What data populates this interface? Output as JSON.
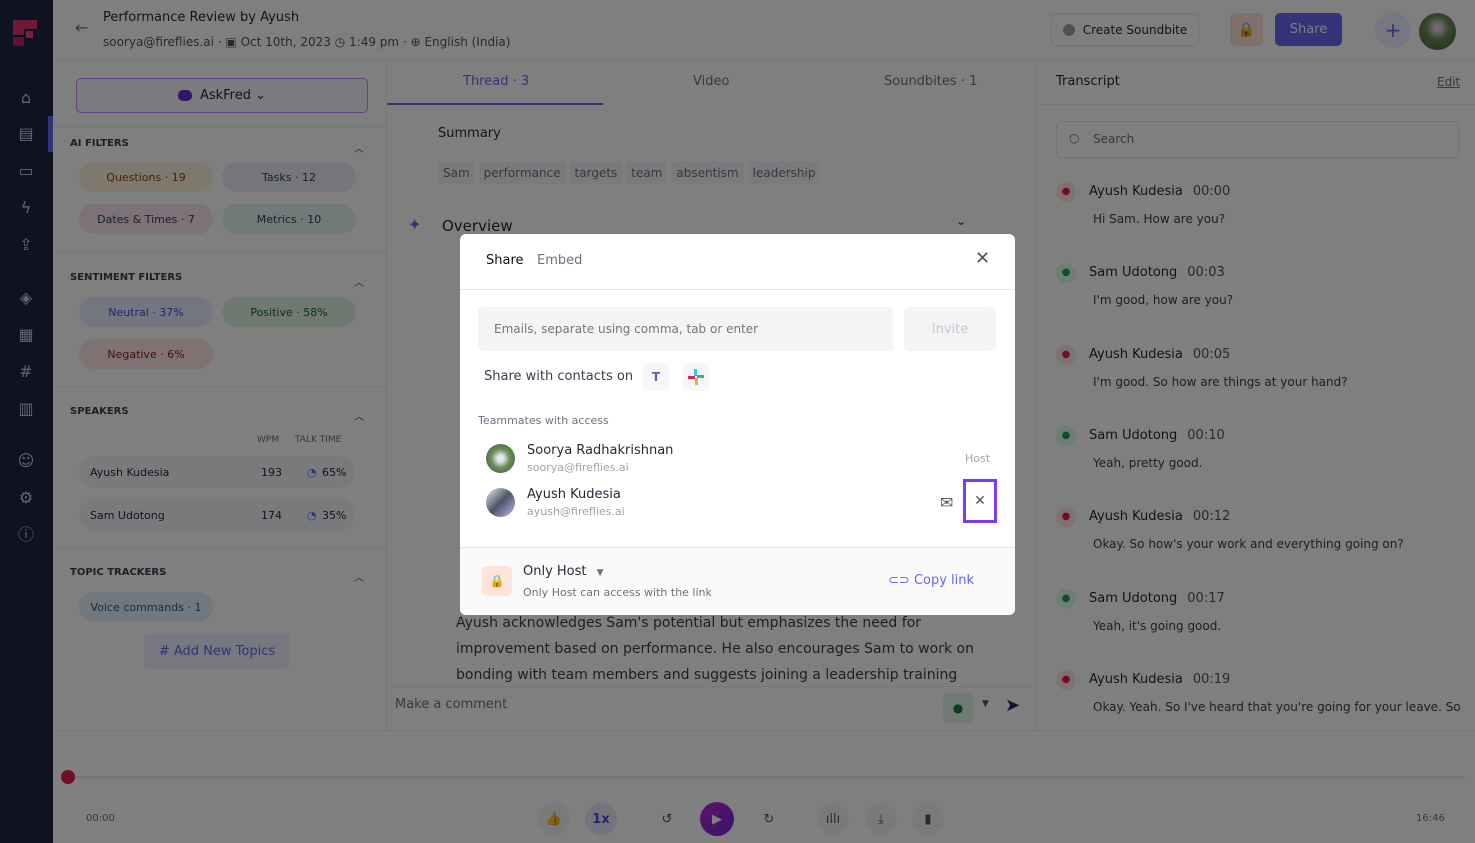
{
  "header": {
    "title": "Performance Review by Ayush",
    "email": "soorya@fireflies.ai",
    "date": "Oct 10th, 2023",
    "time": "1:49 pm",
    "language": "English (India)",
    "create_soundbite": "Create Soundbite",
    "share": "Share"
  },
  "left": {
    "askfred": "AskFred",
    "ai_filters": {
      "title": "AI FILTERS",
      "chips": [
        "Questions · 19",
        "Tasks · 12",
        "Dates & Times · 7",
        "Metrics · 10"
      ]
    },
    "sentiment": {
      "title": "SENTIMENT FILTERS",
      "chips": [
        "Neutral · 37%",
        "Positive · 58%",
        "Negative · 6%"
      ]
    },
    "speakers": {
      "title": "SPEAKERS",
      "col_wpm": "WPM",
      "col_talk": "TALK TIME",
      "rows": [
        {
          "name": "Ayush Kudesia",
          "wpm": "193",
          "talk": "65%",
          "talk_value": 65
        },
        {
          "name": "Sam Udotong",
          "wpm": "174",
          "talk": "35%",
          "talk_value": 35
        }
      ]
    },
    "topics": {
      "title": "TOPIC TRACKERS",
      "chips": [
        "Voice commands · 1"
      ],
      "add": "# Add New Topics"
    }
  },
  "center": {
    "tabs": [
      "Thread · 3",
      "Video",
      "Soundbites · 1"
    ],
    "summary": "Summary",
    "keywords": [
      "Sam",
      "performance",
      "targets",
      "team",
      "absentism",
      "leadership"
    ],
    "overview": "Overview",
    "body": [
      "Ayush acknowledges Sam's potential but emphasizes the need for",
      "improvement based on performance. He also encourages Sam to work on",
      "bonding with team members and suggests joining a leadership training"
    ],
    "comment_placeholder": "Make a comment"
  },
  "transcript": {
    "title": "Transcript",
    "edit": "Edit",
    "search_placeholder": "Search",
    "entries": [
      {
        "name": "Ayush Kudesia",
        "time": "00:00",
        "text": "Hi Sam. How are you?"
      },
      {
        "name": "Sam Udotong",
        "time": "00:03",
        "text": "I'm good, how are you?"
      },
      {
        "name": "Ayush Kudesia",
        "time": "00:05",
        "text": "I'm good. So how are things at your hand?"
      },
      {
        "name": "Sam Udotong",
        "time": "00:10",
        "text": "Yeah, pretty good."
      },
      {
        "name": "Ayush Kudesia",
        "time": "00:12",
        "text": "Okay. So how's your work and everything going on?"
      },
      {
        "name": "Sam Udotong",
        "time": "00:17",
        "text": "Yeah, it's going good."
      },
      {
        "name": "Ayush Kudesia",
        "time": "00:19",
        "text": "Okay. Yeah. So I've heard that you're going for your leave. So"
      }
    ]
  },
  "player": {
    "current": "00:00",
    "duration": "16:46",
    "speed": "1x",
    "progress": 0
  },
  "modal": {
    "tabs": [
      "Share",
      "Embed"
    ],
    "email_placeholder": "Emails, separate using comma, tab or enter",
    "invite": "Invite",
    "share_contacts": "Share with contacts on",
    "teammates_title": "Teammates with access",
    "teammates": [
      {
        "name": "Soorya Radhakrishnan",
        "email": "soorya@fireflies.ai",
        "role": "Host"
      },
      {
        "name": "Ayush Kudesia",
        "email": "ayush@fireflies.ai"
      }
    ],
    "access": "Only Host",
    "access_desc": "Only Host can access with the link",
    "copy_link": "Copy link"
  },
  "colors": {
    "accent": "#6466f1",
    "highlight": "#7c3aed",
    "sidebar": "#1f2542"
  }
}
